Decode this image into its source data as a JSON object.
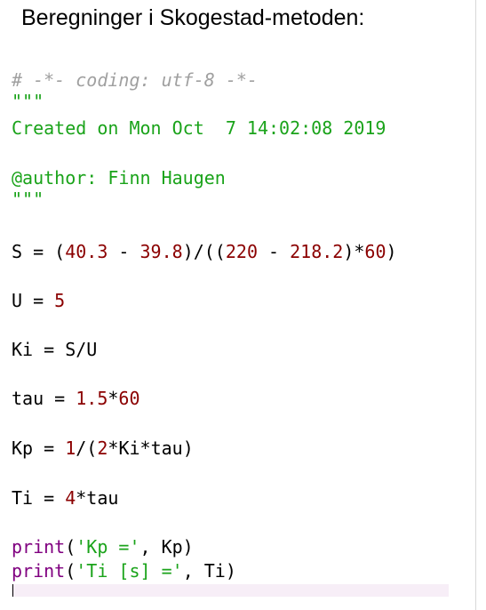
{
  "title": "Beregninger i Skogestad-metoden:",
  "code": {
    "l1": {
      "comment": "# -*- coding: utf-8 -*-"
    },
    "l2": {
      "docstring": "\"\"\""
    },
    "l3": {
      "docstring": "Created on Mon Oct  7 14:02:08 2019"
    },
    "l4": {
      "docstring": "@author: Finn Haugen"
    },
    "l5": {
      "docstring": "\"\"\""
    },
    "l6": {
      "a": "S = (",
      "n1": "40.3",
      "b": " - ",
      "n2": "39.8",
      "c": ")/((",
      "n3": "220",
      "d": " - ",
      "n4": "218.2",
      "e": ")*",
      "n5": "60",
      "f": ")"
    },
    "l7": {
      "a": "U = ",
      "n1": "5"
    },
    "l8": {
      "a": "Ki = S/U"
    },
    "l9": {
      "a": "tau = ",
      "n1": "1.5",
      "b": "*",
      "n2": "60"
    },
    "l10": {
      "a": "Kp = ",
      "n1": "1",
      "b": "/(",
      "n2": "2",
      "c": "*Ki*tau)"
    },
    "l11": {
      "a": "Ti = ",
      "n1": "4",
      "b": "*tau"
    },
    "l12": {
      "fn": "print",
      "a": "(",
      "s": "'Kp ='",
      "b": ", Kp)"
    },
    "l13": {
      "fn": "print",
      "a": "(",
      "s": "'Ti [s] ='",
      "b": ", Ti)"
    }
  }
}
